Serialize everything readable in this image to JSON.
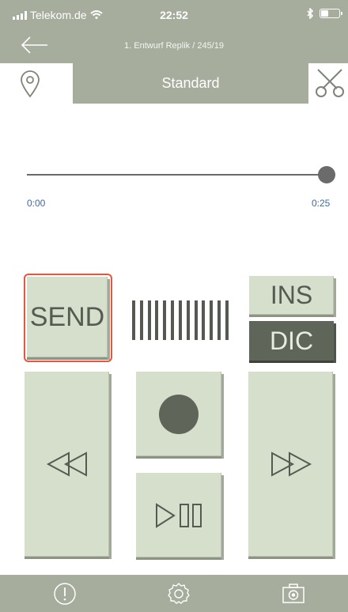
{
  "status_bar": {
    "carrier": "Telekom.de",
    "time": "22:52",
    "battery_level": 0.45
  },
  "header": {
    "document_title": "1. Entwurf Replik / 245/19"
  },
  "tabs": {
    "active_label": "Standard"
  },
  "player": {
    "position_fraction": 1.0,
    "elapsed": "0:00",
    "duration": "0:25"
  },
  "controls": {
    "send_label": "SEND",
    "ins_label": "INS",
    "dic_label": "DIC"
  },
  "icons": {
    "back": "arrow-left-icon",
    "location": "location-pin-icon",
    "cut": "scissors-icon",
    "rewind": "rewind-icon",
    "record": "record-icon",
    "play_pause": "play-pause-icon",
    "fast_forward": "fast-forward-icon",
    "alert": "alert-icon",
    "settings": "gear-icon",
    "camera": "camera-icon"
  },
  "colors": {
    "header_bg": "#a6ad9d",
    "button_bg": "#d6dfcc",
    "button_dark": "#5f6559",
    "send_highlight": "#e8553a",
    "time_text": "#3f6aa0"
  }
}
